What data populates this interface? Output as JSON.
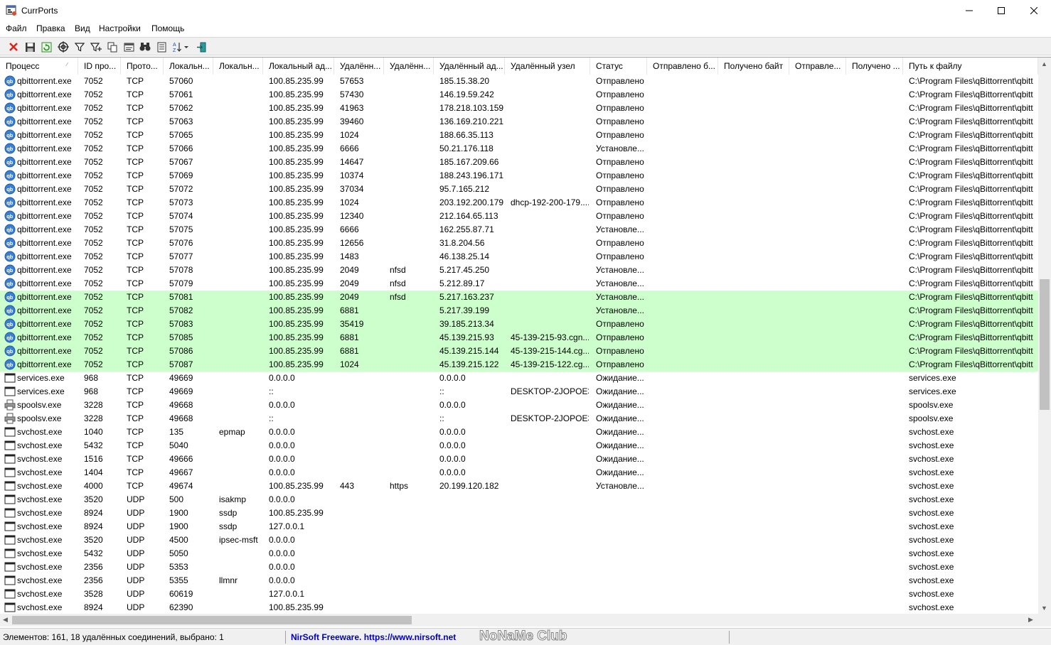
{
  "window": {
    "title": "CurrPorts"
  },
  "menu": [
    "Файл",
    "Правка",
    "Вид",
    "Настройки",
    "Помощь"
  ],
  "toolbar": [
    {
      "name": "close-connection",
      "icon": "red-x-icon"
    },
    {
      "name": "save",
      "icon": "floppy-icon"
    },
    {
      "name": "refresh",
      "icon": "refresh-icon"
    },
    {
      "name": "properties",
      "icon": "target-icon"
    },
    {
      "name": "filter",
      "icon": "funnel-icon"
    },
    {
      "name": "advanced-filter",
      "icon": "funnel-plus-icon"
    },
    {
      "name": "copy",
      "icon": "copy-icon"
    },
    {
      "name": "html-report",
      "icon": "report-icon"
    },
    {
      "name": "find",
      "icon": "binoculars-icon"
    },
    {
      "name": "document",
      "icon": "document-icon"
    },
    {
      "name": "sort",
      "icon": "sort-az-icon"
    },
    {
      "name": "exit",
      "icon": "exit-door-icon"
    }
  ],
  "columns": [
    "Процесс",
    "ID про...",
    "Прото...",
    "Локальн...",
    "Локальн...",
    "Локальный ад...",
    "Удалённ...",
    "Удалённ...",
    "Удалённый ад...",
    "Удалённый узел",
    "Статус",
    "Отправлено б...",
    "Получено байт",
    "Отправле...",
    "Получено ...",
    "Путь к файлу"
  ],
  "rows": [
    [
      "qbittorrent.exe",
      "7052",
      "TCP",
      "57060",
      "",
      "100.85.235.99",
      "57653",
      "",
      "185.15.38.20",
      "",
      "Отправлено",
      "",
      "",
      "",
      "",
      "C:\\Program Files\\qBittorrent\\qbitt"
    ],
    [
      "qbittorrent.exe",
      "7052",
      "TCP",
      "57061",
      "",
      "100.85.235.99",
      "57430",
      "",
      "146.19.59.242",
      "",
      "Отправлено",
      "",
      "",
      "",
      "",
      "C:\\Program Files\\qBittorrent\\qbitt"
    ],
    [
      "qbittorrent.exe",
      "7052",
      "TCP",
      "57062",
      "",
      "100.85.235.99",
      "41963",
      "",
      "178.218.103.159",
      "",
      "Отправлено",
      "",
      "",
      "",
      "",
      "C:\\Program Files\\qBittorrent\\qbitt"
    ],
    [
      "qbittorrent.exe",
      "7052",
      "TCP",
      "57063",
      "",
      "100.85.235.99",
      "39460",
      "",
      "136.169.210.221",
      "",
      "Отправлено",
      "",
      "",
      "",
      "",
      "C:\\Program Files\\qBittorrent\\qbitt"
    ],
    [
      "qbittorrent.exe",
      "7052",
      "TCP",
      "57065",
      "",
      "100.85.235.99",
      "1024",
      "",
      "188.66.35.113",
      "",
      "Отправлено",
      "",
      "",
      "",
      "",
      "C:\\Program Files\\qBittorrent\\qbitt"
    ],
    [
      "qbittorrent.exe",
      "7052",
      "TCP",
      "57066",
      "",
      "100.85.235.99",
      "6666",
      "",
      "50.21.176.118",
      "",
      "Установле...",
      "",
      "",
      "",
      "",
      "C:\\Program Files\\qBittorrent\\qbitt"
    ],
    [
      "qbittorrent.exe",
      "7052",
      "TCP",
      "57067",
      "",
      "100.85.235.99",
      "14647",
      "",
      "185.167.209.66",
      "",
      "Отправлено",
      "",
      "",
      "",
      "",
      "C:\\Program Files\\qBittorrent\\qbitt"
    ],
    [
      "qbittorrent.exe",
      "7052",
      "TCP",
      "57069",
      "",
      "100.85.235.99",
      "10374",
      "",
      "188.243.196.171",
      "",
      "Отправлено",
      "",
      "",
      "",
      "",
      "C:\\Program Files\\qBittorrent\\qbitt"
    ],
    [
      "qbittorrent.exe",
      "7052",
      "TCP",
      "57072",
      "",
      "100.85.235.99",
      "37034",
      "",
      "95.7.165.212",
      "",
      "Отправлено",
      "",
      "",
      "",
      "",
      "C:\\Program Files\\qBittorrent\\qbitt"
    ],
    [
      "qbittorrent.exe",
      "7052",
      "TCP",
      "57073",
      "",
      "100.85.235.99",
      "1024",
      "",
      "203.192.200.179",
      "dhcp-192-200-179....",
      "Отправлено",
      "",
      "",
      "",
      "",
      "C:\\Program Files\\qBittorrent\\qbitt"
    ],
    [
      "qbittorrent.exe",
      "7052",
      "TCP",
      "57074",
      "",
      "100.85.235.99",
      "12340",
      "",
      "212.164.65.113",
      "",
      "Отправлено",
      "",
      "",
      "",
      "",
      "C:\\Program Files\\qBittorrent\\qbitt"
    ],
    [
      "qbittorrent.exe",
      "7052",
      "TCP",
      "57075",
      "",
      "100.85.235.99",
      "6666",
      "",
      "162.255.87.71",
      "",
      "Установле...",
      "",
      "",
      "",
      "",
      "C:\\Program Files\\qBittorrent\\qbitt"
    ],
    [
      "qbittorrent.exe",
      "7052",
      "TCP",
      "57076",
      "",
      "100.85.235.99",
      "12656",
      "",
      "31.8.204.56",
      "",
      "Отправлено",
      "",
      "",
      "",
      "",
      "C:\\Program Files\\qBittorrent\\qbitt"
    ],
    [
      "qbittorrent.exe",
      "7052",
      "TCP",
      "57077",
      "",
      "100.85.235.99",
      "1483",
      "",
      "46.138.25.14",
      "",
      "Отправлено",
      "",
      "",
      "",
      "",
      "C:\\Program Files\\qBittorrent\\qbitt"
    ],
    [
      "qbittorrent.exe",
      "7052",
      "TCP",
      "57078",
      "",
      "100.85.235.99",
      "2049",
      "nfsd",
      "5.217.45.250",
      "",
      "Установле...",
      "",
      "",
      "",
      "",
      "C:\\Program Files\\qBittorrent\\qbitt"
    ],
    [
      "qbittorrent.exe",
      "7052",
      "TCP",
      "57079",
      "",
      "100.85.235.99",
      "2049",
      "nfsd",
      "5.212.89.17",
      "",
      "Установле...",
      "",
      "",
      "",
      "",
      "C:\\Program Files\\qBittorrent\\qbitt"
    ],
    [
      "qbittorrent.exe",
      "7052",
      "TCP",
      "57081",
      "",
      "100.85.235.99",
      "2049",
      "nfsd",
      "5.217.163.237",
      "",
      "Установле...",
      "",
      "",
      "",
      "",
      "C:\\Program Files\\qBittorrent\\qbitt"
    ],
    [
      "qbittorrent.exe",
      "7052",
      "TCP",
      "57082",
      "",
      "100.85.235.99",
      "6881",
      "",
      "5.217.39.199",
      "",
      "Установле...",
      "",
      "",
      "",
      "",
      "C:\\Program Files\\qBittorrent\\qbitt"
    ],
    [
      "qbittorrent.exe",
      "7052",
      "TCP",
      "57083",
      "",
      "100.85.235.99",
      "35419",
      "",
      "39.185.213.34",
      "",
      "Отправлено",
      "",
      "",
      "",
      "",
      "C:\\Program Files\\qBittorrent\\qbitt"
    ],
    [
      "qbittorrent.exe",
      "7052",
      "TCP",
      "57085",
      "",
      "100.85.235.99",
      "6881",
      "",
      "45.139.215.93",
      "45-139-215-93.cgn....",
      "Отправлено",
      "",
      "",
      "",
      "",
      "C:\\Program Files\\qBittorrent\\qbitt"
    ],
    [
      "qbittorrent.exe",
      "7052",
      "TCP",
      "57086",
      "",
      "100.85.235.99",
      "6881",
      "",
      "45.139.215.144",
      "45-139-215-144.cg....",
      "Отправлено",
      "",
      "",
      "",
      "",
      "C:\\Program Files\\qBittorrent\\qbitt"
    ],
    [
      "qbittorrent.exe",
      "7052",
      "TCP",
      "57087",
      "",
      "100.85.235.99",
      "1024",
      "",
      "45.139.215.122",
      "45-139-215-122.cg....",
      "Отправлено",
      "",
      "",
      "",
      "",
      "C:\\Program Files\\qBittorrent\\qbitt"
    ],
    [
      "services.exe",
      "968",
      "TCP",
      "49669",
      "",
      "0.0.0.0",
      "",
      "",
      "0.0.0.0",
      "",
      "Ожидание...",
      "",
      "",
      "",
      "",
      "services.exe"
    ],
    [
      "services.exe",
      "968",
      "TCP",
      "49669",
      "",
      "::",
      "",
      "",
      "::",
      "DESKTOP-2JOPOE3",
      "Ожидание...",
      "",
      "",
      "",
      "",
      "services.exe"
    ],
    [
      "spoolsv.exe",
      "3228",
      "TCP",
      "49668",
      "",
      "0.0.0.0",
      "",
      "",
      "0.0.0.0",
      "",
      "Ожидание...",
      "",
      "",
      "",
      "",
      "spoolsv.exe"
    ],
    [
      "spoolsv.exe",
      "3228",
      "TCP",
      "49668",
      "",
      "::",
      "",
      "",
      "::",
      "DESKTOP-2JOPOE3",
      "Ожидание...",
      "",
      "",
      "",
      "",
      "spoolsv.exe"
    ],
    [
      "svchost.exe",
      "1040",
      "TCP",
      "135",
      "epmap",
      "0.0.0.0",
      "",
      "",
      "0.0.0.0",
      "",
      "Ожидание...",
      "",
      "",
      "",
      "",
      "svchost.exe"
    ],
    [
      "svchost.exe",
      "5432",
      "TCP",
      "5040",
      "",
      "0.0.0.0",
      "",
      "",
      "0.0.0.0",
      "",
      "Ожидание...",
      "",
      "",
      "",
      "",
      "svchost.exe"
    ],
    [
      "svchost.exe",
      "1516",
      "TCP",
      "49666",
      "",
      "0.0.0.0",
      "",
      "",
      "0.0.0.0",
      "",
      "Ожидание...",
      "",
      "",
      "",
      "",
      "svchost.exe"
    ],
    [
      "svchost.exe",
      "1404",
      "TCP",
      "49667",
      "",
      "0.0.0.0",
      "",
      "",
      "0.0.0.0",
      "",
      "Ожидание...",
      "",
      "",
      "",
      "",
      "svchost.exe"
    ],
    [
      "svchost.exe",
      "4000",
      "TCP",
      "49674",
      "",
      "100.85.235.99",
      "443",
      "https",
      "20.199.120.182",
      "",
      "Установле...",
      "",
      "",
      "",
      "",
      "svchost.exe"
    ],
    [
      "svchost.exe",
      "3520",
      "UDP",
      "500",
      "isakmp",
      "0.0.0.0",
      "",
      "",
      "",
      "",
      "",
      "",
      "",
      "",
      "",
      "svchost.exe"
    ],
    [
      "svchost.exe",
      "8924",
      "UDP",
      "1900",
      "ssdp",
      "100.85.235.99",
      "",
      "",
      "",
      "",
      "",
      "",
      "",
      "",
      "",
      "svchost.exe"
    ],
    [
      "svchost.exe",
      "8924",
      "UDP",
      "1900",
      "ssdp",
      "127.0.0.1",
      "",
      "",
      "",
      "",
      "",
      "",
      "",
      "",
      "",
      "svchost.exe"
    ],
    [
      "svchost.exe",
      "3520",
      "UDP",
      "4500",
      "ipsec-msft",
      "0.0.0.0",
      "",
      "",
      "",
      "",
      "",
      "",
      "",
      "",
      "",
      "svchost.exe"
    ],
    [
      "svchost.exe",
      "5432",
      "UDP",
      "5050",
      "",
      "0.0.0.0",
      "",
      "",
      "",
      "",
      "",
      "",
      "",
      "",
      "",
      "svchost.exe"
    ],
    [
      "svchost.exe",
      "2356",
      "UDP",
      "5353",
      "",
      "0.0.0.0",
      "",
      "",
      "",
      "",
      "",
      "",
      "",
      "",
      "",
      "svchost.exe"
    ],
    [
      "svchost.exe",
      "2356",
      "UDP",
      "5355",
      "llmnr",
      "0.0.0.0",
      "",
      "",
      "",
      "",
      "",
      "",
      "",
      "",
      "",
      "svchost.exe"
    ],
    [
      "svchost.exe",
      "3528",
      "UDP",
      "60619",
      "",
      "127.0.0.1",
      "",
      "",
      "",
      "",
      "",
      "",
      "",
      "",
      "",
      "svchost.exe"
    ],
    [
      "svchost.exe",
      "8924",
      "UDP",
      "62390",
      "",
      "100.85.235.99",
      "",
      "",
      "",
      "",
      "",
      "",
      "",
      "",
      "",
      "svchost.exe"
    ]
  ],
  "highlight_color": "#ccffcc",
  "status": {
    "summary": "Элементов: 161, 18 удалённых соединений, выбрано: 1",
    "link": "NirSoft Freeware. https://www.nirsoft.net",
    "watermark": "NoNaMe Club"
  }
}
